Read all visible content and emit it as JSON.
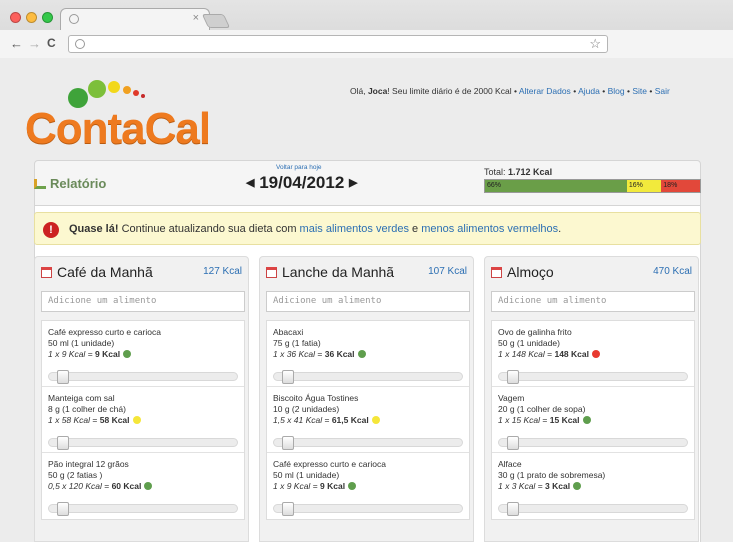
{
  "browser": {
    "tab_close": "×",
    "back": "←",
    "forward": "→",
    "reload": "C",
    "star": "☆",
    "lights": [
      "#fc605c",
      "#fdbc40",
      "#34c84a"
    ]
  },
  "header": {
    "logo_text": "ContaCal",
    "greeting_prefix": "Olá, ",
    "user_name": "Joca",
    "greeting_suffix": "! Seu limite diário é de 2000 Kcal •",
    "links": [
      "Alterar Dados",
      "Ajuda",
      "Blog",
      "Site",
      "Sair"
    ],
    "separator": "•"
  },
  "report": {
    "label": "Relatório",
    "back_to_today": "Voltar para hoje",
    "prev_arrow": "◀",
    "next_arrow": "▶",
    "date": "19/04/2012",
    "total_label": "Total:",
    "total_value": "1.712 Kcal",
    "segments": [
      {
        "label": "66%",
        "percent": 66,
        "color": "#6a9e48"
      },
      {
        "label": "16%",
        "percent": 16,
        "color": "#f2ea3c"
      },
      {
        "label": "18%",
        "percent": 18,
        "color": "#e2483a"
      }
    ]
  },
  "alert": {
    "icon": "!",
    "strong": "Quase lá!",
    "text1": " Continue atualizando sua dieta com ",
    "link1": "mais alimentos verdes",
    "text2": " e ",
    "link2": "menos alimentos vermelhos",
    "text3": "."
  },
  "colors": {
    "green": "#5f9e4d",
    "yellow": "#f5e63a",
    "red": "#e83a30"
  },
  "meals": [
    {
      "title": "Café da Manhã",
      "kcal": "127 Kcal",
      "placeholder": "Adicione um alimento",
      "items": [
        {
          "name": "Café expresso curto e carioca",
          "portion": "50 ml (1 unidade)",
          "calc": "1 x 9 Kcal",
          "result": "9 Kcal",
          "status": "green"
        },
        {
          "name": "Manteiga com sal",
          "portion": "8 g (1 colher de chá)",
          "calc": "1 x 58 Kcal",
          "result": "58 Kcal",
          "status": "yellow"
        },
        {
          "name": "Pão integral 12 grãos",
          "portion": "50 g (2 fatias )",
          "calc": "0,5 x 120 Kcal",
          "result": "60 Kcal",
          "status": "green"
        }
      ]
    },
    {
      "title": "Lanche da Manhã",
      "kcal": "107 Kcal",
      "placeholder": "Adicione um alimento",
      "items": [
        {
          "name": "Abacaxi",
          "portion": "75 g (1 fatia)",
          "calc": "1 x 36 Kcal",
          "result": "36 Kcal",
          "status": "green"
        },
        {
          "name": "Biscoito Água Tostines",
          "portion": "10 g (2 unidades)",
          "calc": "1,5 x 41 Kcal",
          "result": "61,5 Kcal",
          "status": "yellow"
        },
        {
          "name": "Café expresso curto e carioca",
          "portion": "50 ml (1 unidade)",
          "calc": "1 x 9 Kcal",
          "result": "9 Kcal",
          "status": "green"
        }
      ]
    },
    {
      "title": "Almoço",
      "kcal": "470 Kcal",
      "placeholder": "Adicione um alimento",
      "items": [
        {
          "name": "Ovo de galinha frito",
          "portion": "50 g (1 unidade)",
          "calc": "1 x 148 Kcal",
          "result": "148 Kcal",
          "status": "red"
        },
        {
          "name": "Vagem",
          "portion": "20 g (1 colher de sopa)",
          "calc": "1 x 15 Kcal",
          "result": "15 Kcal",
          "status": "green"
        },
        {
          "name": "Alface",
          "portion": "30 g (1 prato de sobremesa)",
          "calc": "1 x 3 Kcal",
          "result": "3 Kcal",
          "status": "green"
        }
      ]
    }
  ]
}
